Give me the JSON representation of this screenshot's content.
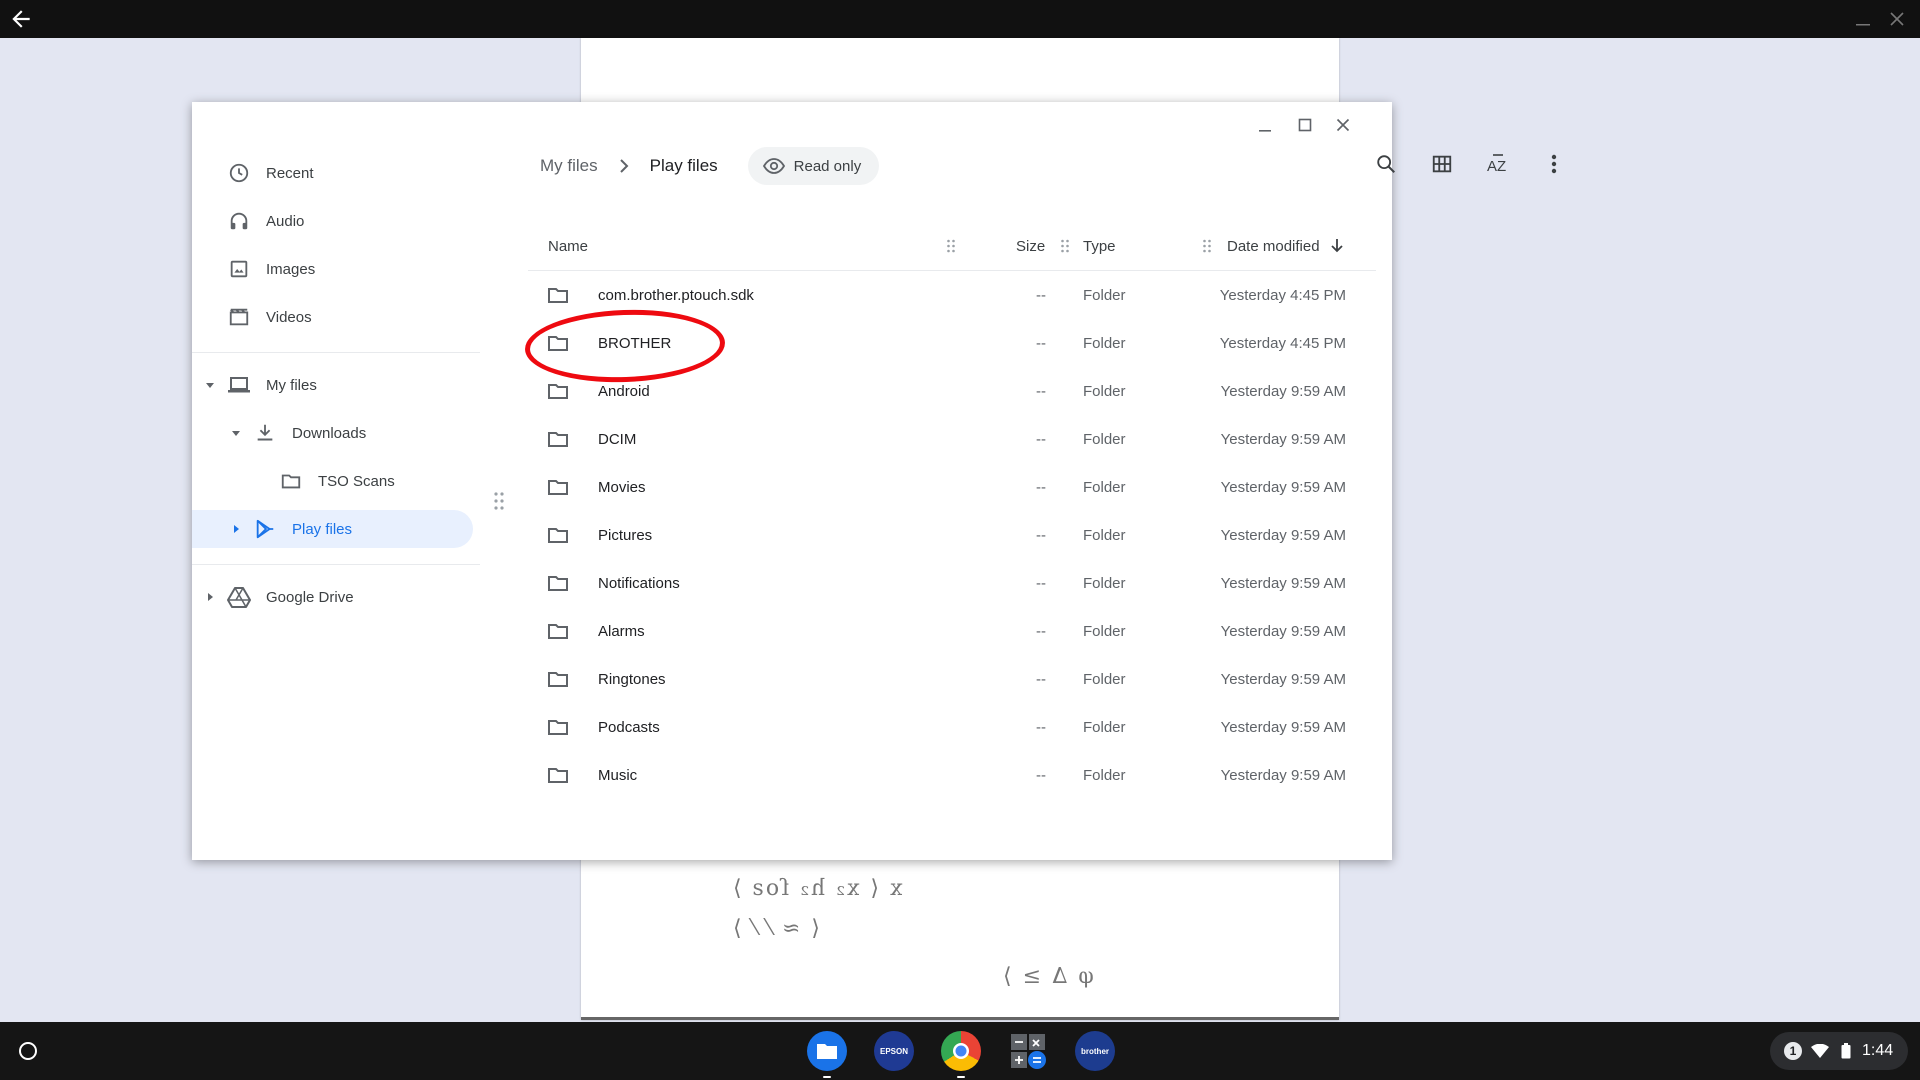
{
  "window": {
    "minimize_label": "Minimize",
    "maximize_label": "Maximize",
    "close_label": "Close"
  },
  "sidebar": {
    "items": [
      {
        "label": "Recent",
        "icon": "clock-icon"
      },
      {
        "label": "Audio",
        "icon": "headphones-icon"
      },
      {
        "label": "Images",
        "icon": "image-icon"
      },
      {
        "label": "Videos",
        "icon": "film-icon"
      },
      {
        "label": "My files",
        "icon": "laptop-icon"
      },
      {
        "label": "Downloads",
        "icon": "download-icon"
      },
      {
        "label": "TSO Scans",
        "icon": "folder-icon"
      },
      {
        "label": "Play files",
        "icon": "play-store-icon"
      },
      {
        "label": "Google Drive",
        "icon": "drive-icon"
      }
    ],
    "active_item": "Play files"
  },
  "breadcrumb": {
    "root": "My files",
    "current": "Play files",
    "badge": "Read only"
  },
  "columns": {
    "name": "Name",
    "size": "Size",
    "type": "Type",
    "date": "Date modified"
  },
  "files": [
    {
      "name": "com.brother.ptouch.sdk",
      "size": "--",
      "type": "Folder",
      "date": "Yesterday 4:45 PM"
    },
    {
      "name": "BROTHER",
      "size": "--",
      "type": "Folder",
      "date": "Yesterday 4:45 PM"
    },
    {
      "name": "Android",
      "size": "--",
      "type": "Folder",
      "date": "Yesterday 9:59 AM"
    },
    {
      "name": "DCIM",
      "size": "--",
      "type": "Folder",
      "date": "Yesterday 9:59 AM"
    },
    {
      "name": "Movies",
      "size": "--",
      "type": "Folder",
      "date": "Yesterday 9:59 AM"
    },
    {
      "name": "Pictures",
      "size": "--",
      "type": "Folder",
      "date": "Yesterday 9:59 AM"
    },
    {
      "name": "Notifications",
      "size": "--",
      "type": "Folder",
      "date": "Yesterday 9:59 AM"
    },
    {
      "name": "Alarms",
      "size": "--",
      "type": "Folder",
      "date": "Yesterday 9:59 AM"
    },
    {
      "name": "Ringtones",
      "size": "--",
      "type": "Folder",
      "date": "Yesterday 9:59 AM"
    },
    {
      "name": "Podcasts",
      "size": "--",
      "type": "Folder",
      "date": "Yesterday 9:59 AM"
    },
    {
      "name": "Music",
      "size": "--",
      "type": "Folder",
      "date": "Yesterday 9:59 AM"
    }
  ],
  "shelf": {
    "apps": [
      {
        "name": "files-app",
        "color": "#1a73e8"
      },
      {
        "name": "epson-app",
        "label": "EPSON",
        "color": "#1f3a93"
      },
      {
        "name": "chrome-app",
        "color": "#ea4335"
      },
      {
        "name": "calculator-app",
        "color": "#5f6368"
      },
      {
        "name": "brother-app",
        "label": "brother",
        "color": "#1d3c8f"
      }
    ],
    "notification_count": "1",
    "time": "1:44"
  },
  "colors": {
    "accent": "#1a73e8",
    "active_bg": "#e8f0fe",
    "annotation": "#ee0a10",
    "desktop": "#e3e6f2"
  }
}
